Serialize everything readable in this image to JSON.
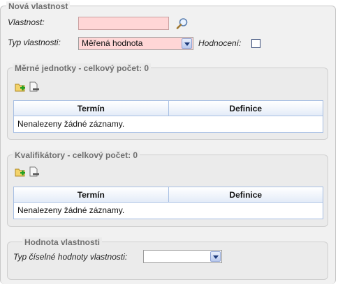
{
  "main": {
    "legend": "Nová vlastnost",
    "property_label": "Vlastnost:",
    "property_value": "",
    "type_label": "Typ vlastnosti:",
    "type_selected": "Měřená hodnota",
    "evaluation_label": "Hodnocení:",
    "evaluation_checked": false
  },
  "units": {
    "legend": "Měrné jednotky - celkový počet: 0",
    "columns": [
      "Termín",
      "Definice"
    ],
    "empty_text": "Nenalezeny žádné záznamy."
  },
  "qualifiers": {
    "legend": "Kvalifikátory - celkový počet: 0",
    "columns": [
      "Termín",
      "Definice"
    ],
    "empty_text": "Nenalezeny žádné záznamy."
  },
  "property_value_section": {
    "legend": "Hodnota vlastnosti",
    "numeric_type_label": "Typ číselné hodnoty vlastnosti:",
    "numeric_type_selected": ""
  },
  "icons": {
    "search": "magnifier-icon",
    "add": "add-folder-icon",
    "remove": "remove-document-icon"
  },
  "colors": {
    "required_field": "#ffd6d6",
    "grid_border": "#a7bfe3",
    "legend_text": "#6f6f6f"
  }
}
